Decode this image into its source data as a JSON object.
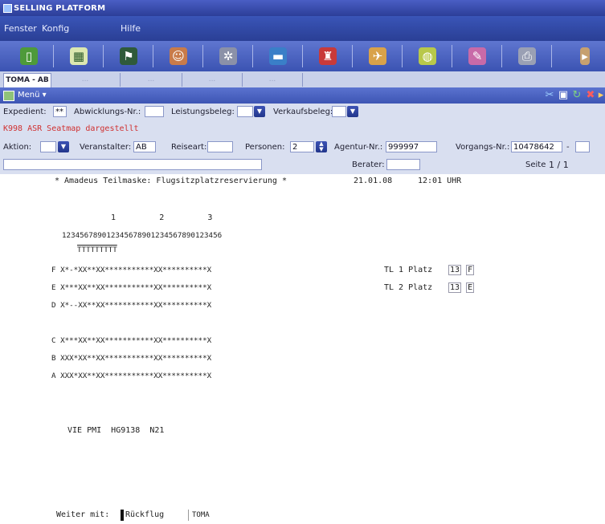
{
  "app": {
    "title": "SELLING PLATFORM"
  },
  "menubar": {
    "items": [
      "Fenster",
      "Konfig",
      "Hilfe"
    ]
  },
  "toolbar": {
    "icons": [
      "book-icon",
      "calendar-icon",
      "flag-icon",
      "person-icon",
      "settings-icon",
      "car-icon",
      "agent-icon",
      "plane-icon",
      "globe-icon",
      "ticket-icon",
      "print-icon"
    ]
  },
  "tabs": [
    {
      "label": "TOMA - AB"
    },
    {
      "label": "..."
    },
    {
      "label": "..."
    },
    {
      "label": "..."
    },
    {
      "label": "..."
    }
  ],
  "menu2": {
    "label": "Menü ▾"
  },
  "form": {
    "expedient_label": "Expedient:",
    "expedient_value": "**",
    "abwicklung_label": "Abwicklungs-Nr.:",
    "abwicklung_value": "",
    "leistungsbeleg_label": "Leistungsbeleg:",
    "leistungsbeleg_value": "",
    "verkaufsbeleg_label": "Verkaufsbeleg:",
    "verkaufsbeleg_value": "",
    "message": "K998 ASR Seatmap dargestellt",
    "aktion_label": "Aktion:",
    "aktion_value": "",
    "veranstalter_label": "Veranstalter:",
    "veranstalter_value": "AB",
    "reiseart_label": "Reiseart:",
    "reiseart_value": "",
    "personen_label": "Personen:",
    "personen_value": "2",
    "agentur_label": "Agentur-Nr.:",
    "agentur_value": "999997",
    "vorgang_label": "Vorgangs-Nr.:",
    "vorgang_value": "10478642",
    "vorgang_sep": "-",
    "vorgang_suffix": "",
    "berater_label": "Berater:",
    "berater_value": "",
    "seite_label": "Seite",
    "seite_value": "1 / 1",
    "freetext_value": ""
  },
  "terminal": {
    "header": "* Amadeus Teilmaske: Flugsitzplatzreservierung *",
    "date": "21.01.08",
    "time": "12:01 UHR",
    "col_tens": "1         2         3",
    "col_units": "123456789012345678901234567890123456",
    "row_marker": "TTTTTTTTT",
    "rows": [
      "F X*-*XX**XX***********XX**********X",
      "E X***XX**XX***********XX**********X",
      "D X*--XX**XX***********XX**********X",
      "",
      "C X***XX**XX***********XX**********X",
      "B XXX*XX**XX***********XX**********X",
      "A XXX*XX**XX***********XX**********X"
    ],
    "tl1_label": "TL 1 Platz",
    "tl1_row": "13",
    "tl1_seat": "F",
    "tl2_label": "TL 2 Platz",
    "tl2_row": "13",
    "tl2_seat": "E",
    "flight": "VIE PMI  HG9138  N21",
    "weiter_label": "Weiter mit:",
    "weiter_value": "Rückflug",
    "toma": "TOMA"
  }
}
